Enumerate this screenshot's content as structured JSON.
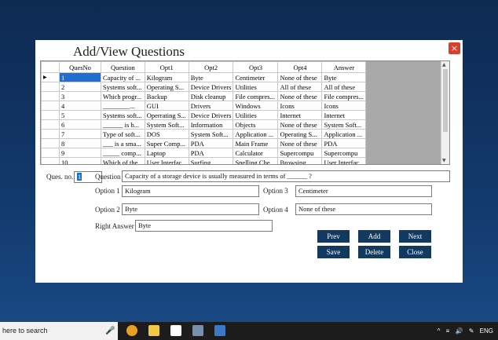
{
  "window": {
    "title": "Add/View Questions",
    "close_glyph": "×"
  },
  "grid": {
    "columns": [
      "QuesNo",
      "Question",
      "Opt1",
      "Opt2",
      "Opt3",
      "Opt4",
      "Answer"
    ],
    "current_row_marker": "▶",
    "rows": [
      [
        "1",
        "Capacity of ...",
        "Kilogram",
        "Byte",
        "Centimeter",
        "None of these",
        "Byte"
      ],
      [
        "2",
        "Systems soft...",
        "Operating S...",
        "Device Drivers",
        "Utilities",
        "All of these",
        "All of these"
      ],
      [
        "3",
        "Which progr...",
        "Backup",
        "Disk cleanup",
        "File compres...",
        "None of these",
        "File compres..."
      ],
      [
        "4",
        "________...",
        "GUI",
        "Drivers",
        "Windows",
        "Icons",
        "Icons"
      ],
      [
        "5",
        "Systems soft...",
        "Operrating S...",
        "Device Drivers",
        "Utilities",
        "Internet",
        "Internet"
      ],
      [
        "6",
        "______ is b...",
        "System Soft...",
        "Information",
        "Objects",
        "None of these",
        "System Soft..."
      ],
      [
        "7",
        "Type of soft...",
        "DOS",
        "System Soft...",
        "Application ...",
        "Operating S...",
        "Application ..."
      ],
      [
        "8",
        "___ is a sma...",
        "Super Comp...",
        "PDA",
        "Main Frame",
        "None of these",
        "PDA"
      ],
      [
        "9",
        "_____ comp...",
        "Laptop",
        "PDA",
        "Calculator",
        "Supercompu",
        "Supercompu"
      ],
      [
        "10",
        "Which of the...",
        "User Interfac...",
        "Surfing",
        "Spelling Che...",
        "Browsing",
        "User Interfac..."
      ]
    ]
  },
  "form": {
    "ques_no_label": "Ques. no.",
    "ques_no_value": "1",
    "question_label": "Question",
    "question_value": "Capacity of a storage device is usually measured in terms of ______ ?",
    "option1_label": "Option 1",
    "option1_value": "Kilogram",
    "option2_label": "Option 2",
    "option2_value": "Byte",
    "option3_label": "Option 3",
    "option3_value": "Centimeter",
    "option4_label": "Option 4",
    "option4_value": "None of these",
    "answer_label": "Right Answer",
    "answer_value": "Byte"
  },
  "buttons": {
    "prev": "Prev",
    "add": "Add",
    "next": "Next",
    "save": "Save",
    "delete": "Delete",
    "close": "Close"
  },
  "taskbar": {
    "search_text": "here to search",
    "tray_language": "ENG"
  },
  "colors": {
    "button_bg": "#14395f",
    "selection": "#1e6fd1",
    "close_red": "#d9402b"
  }
}
